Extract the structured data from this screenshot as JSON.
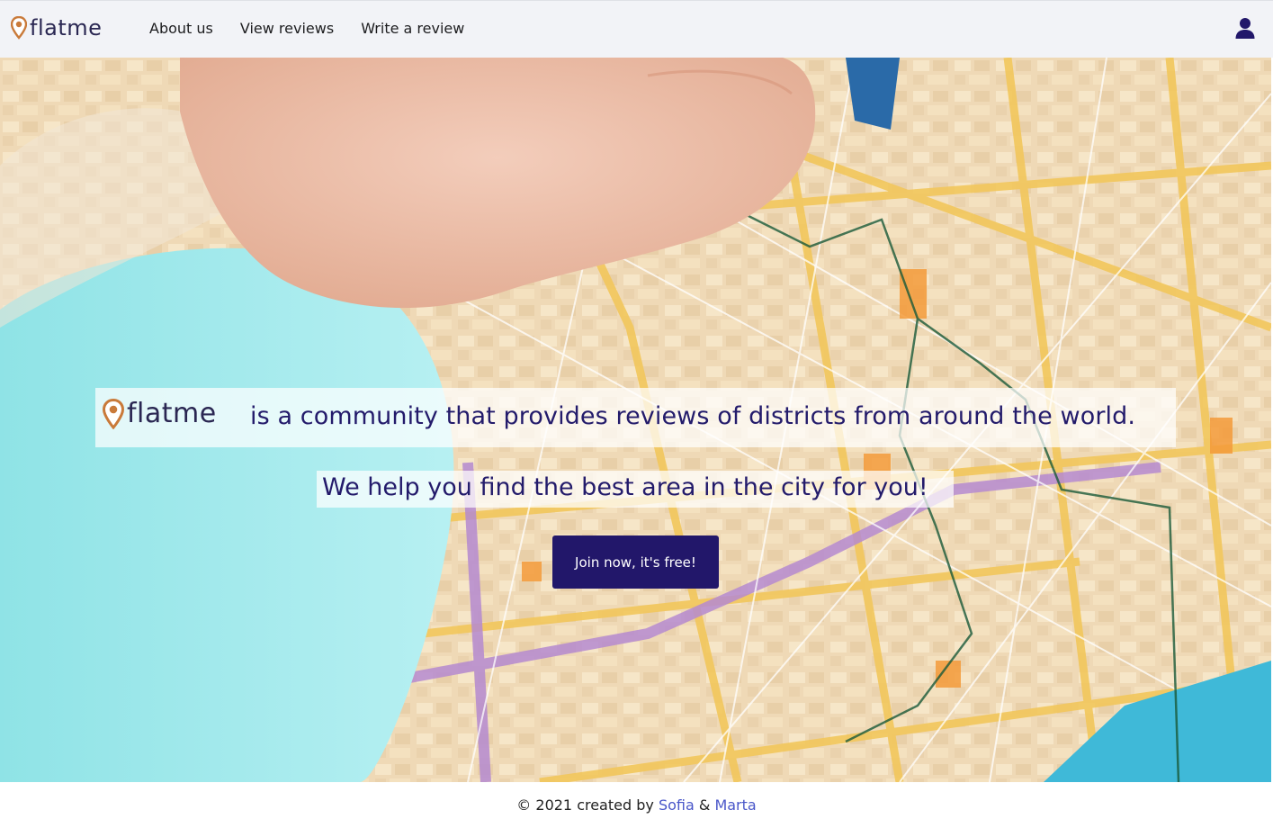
{
  "brand": {
    "name": "flatme",
    "pin_icon": "map-pin-icon",
    "pin_color": "#c97a3a",
    "text_color": "#2a2752"
  },
  "nav": {
    "links": [
      {
        "label": "About us"
      },
      {
        "label": "View reviews"
      },
      {
        "label": "Write a review"
      }
    ],
    "user_icon": "user-icon"
  },
  "hero": {
    "background": "street-map-photo",
    "tagline_brand": "flatme",
    "tagline": "is a community that provides reviews of districts from around the world.",
    "subline": "We help you find the best area in the city for you!",
    "cta_label": "Join now, it's free!"
  },
  "colors": {
    "primary": "#22176a",
    "heading": "#231b6b",
    "link": "#4a57c9"
  },
  "footer": {
    "prefix": "© 2021 created by",
    "author1": "Sofia",
    "separator": "&",
    "author2": "Marta"
  }
}
